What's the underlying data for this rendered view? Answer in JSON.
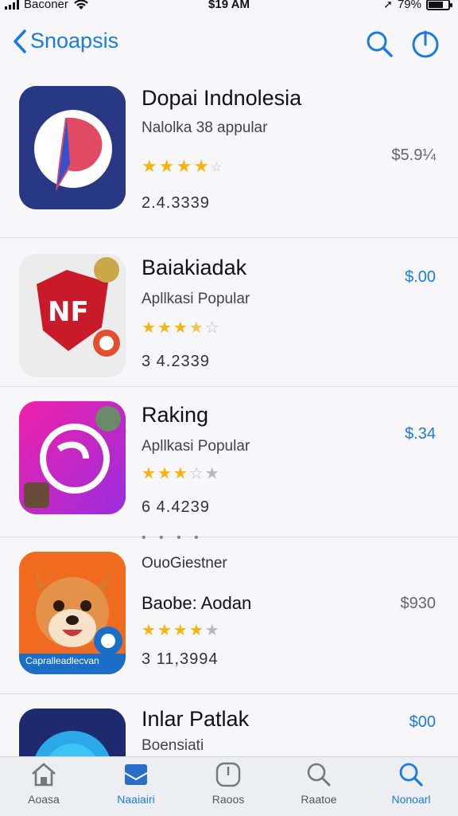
{
  "status_bar": {
    "carrier": "Baconer",
    "time": "$19 AM",
    "battery": "79%"
  },
  "nav": {
    "back_label": "Snoapsis"
  },
  "apps": [
    {
      "title": "Dopai Indnolesia",
      "subtitle": "Nalolka 38 appular",
      "rating_stars": 4,
      "downloads": "2.4.3339",
      "price": "$5.9¼",
      "price_color": "#666666",
      "icon_colors": [
        "#2a3a8a",
        "#1d2466",
        "#e54a5a"
      ]
    },
    {
      "title": "Baiakiadak",
      "subtitle": "Apllkasi Popular",
      "rating_stars": 3.5,
      "downloads": "3 4.2339",
      "price": "$.00",
      "price_color": "#1a7ce0",
      "icon_colors": [
        "#eeeeee",
        "#c81a28",
        "#e03050"
      ]
    },
    {
      "title": "Raking",
      "subtitle": "Apllkasi Popular",
      "rating_stars": 3,
      "downloads": "6 4.4239",
      "price": "$.34",
      "price_color": "#1a7ce0",
      "icon_colors": [
        "#e020b0",
        "#9a28e0",
        "#ffffff"
      ]
    },
    {
      "publisher": "OuoGiestner",
      "title": "Baobe: Aodan",
      "rating_stars": 4,
      "downloads": "3 11,3994",
      "price": "$930",
      "price_color": "#666666",
      "icon_caption": "Capralleadlecvan",
      "icon_colors": [
        "#f07a20",
        "#1a6ec8",
        "#e08a4a"
      ]
    },
    {
      "title": "Inlar Patlak",
      "subtitle": "Boensiati",
      "price": "$00",
      "price_color": "#1a7ce0",
      "icon_colors": [
        "#1d2a6e",
        "#2aa8e8"
      ]
    }
  ],
  "tabs": [
    {
      "label": "Aoasa",
      "icon": "home-icon"
    },
    {
      "label": "Naaiairi",
      "icon": "inbox-icon"
    },
    {
      "label": "Raoos",
      "icon": "timer-icon"
    },
    {
      "label": "Raatoe",
      "icon": "search-icon"
    },
    {
      "label": "Nonoarl",
      "icon": "search-icon"
    }
  ],
  "active_tab": 4,
  "accent_color": "#1a7ce0"
}
